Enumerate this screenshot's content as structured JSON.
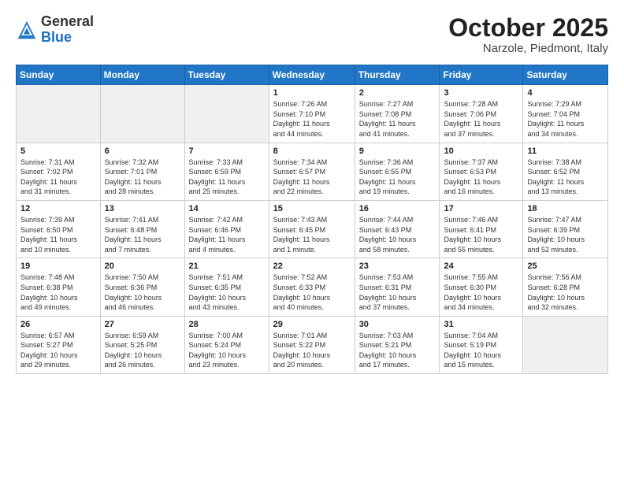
{
  "header": {
    "logo_general": "General",
    "logo_blue": "Blue",
    "month_title": "October 2025",
    "location": "Narzole, Piedmont, Italy"
  },
  "weekdays": [
    "Sunday",
    "Monday",
    "Tuesday",
    "Wednesday",
    "Thursday",
    "Friday",
    "Saturday"
  ],
  "weeks": [
    [
      {
        "day": "",
        "info": ""
      },
      {
        "day": "",
        "info": ""
      },
      {
        "day": "",
        "info": ""
      },
      {
        "day": "1",
        "info": "Sunrise: 7:26 AM\nSunset: 7:10 PM\nDaylight: 11 hours\nand 44 minutes."
      },
      {
        "day": "2",
        "info": "Sunrise: 7:27 AM\nSunset: 7:08 PM\nDaylight: 11 hours\nand 41 minutes."
      },
      {
        "day": "3",
        "info": "Sunrise: 7:28 AM\nSunset: 7:06 PM\nDaylight: 11 hours\nand 37 minutes."
      },
      {
        "day": "4",
        "info": "Sunrise: 7:29 AM\nSunset: 7:04 PM\nDaylight: 11 hours\nand 34 minutes."
      }
    ],
    [
      {
        "day": "5",
        "info": "Sunrise: 7:31 AM\nSunset: 7:02 PM\nDaylight: 11 hours\nand 31 minutes."
      },
      {
        "day": "6",
        "info": "Sunrise: 7:32 AM\nSunset: 7:01 PM\nDaylight: 11 hours\nand 28 minutes."
      },
      {
        "day": "7",
        "info": "Sunrise: 7:33 AM\nSunset: 6:59 PM\nDaylight: 11 hours\nand 25 minutes."
      },
      {
        "day": "8",
        "info": "Sunrise: 7:34 AM\nSunset: 6:57 PM\nDaylight: 11 hours\nand 22 minutes."
      },
      {
        "day": "9",
        "info": "Sunrise: 7:36 AM\nSunset: 6:55 PM\nDaylight: 11 hours\nand 19 minutes."
      },
      {
        "day": "10",
        "info": "Sunrise: 7:37 AM\nSunset: 6:53 PM\nDaylight: 11 hours\nand 16 minutes."
      },
      {
        "day": "11",
        "info": "Sunrise: 7:38 AM\nSunset: 6:52 PM\nDaylight: 11 hours\nand 13 minutes."
      }
    ],
    [
      {
        "day": "12",
        "info": "Sunrise: 7:39 AM\nSunset: 6:50 PM\nDaylight: 11 hours\nand 10 minutes."
      },
      {
        "day": "13",
        "info": "Sunrise: 7:41 AM\nSunset: 6:48 PM\nDaylight: 11 hours\nand 7 minutes."
      },
      {
        "day": "14",
        "info": "Sunrise: 7:42 AM\nSunset: 6:46 PM\nDaylight: 11 hours\nand 4 minutes."
      },
      {
        "day": "15",
        "info": "Sunrise: 7:43 AM\nSunset: 6:45 PM\nDaylight: 11 hours\nand 1 minute."
      },
      {
        "day": "16",
        "info": "Sunrise: 7:44 AM\nSunset: 6:43 PM\nDaylight: 10 hours\nand 58 minutes."
      },
      {
        "day": "17",
        "info": "Sunrise: 7:46 AM\nSunset: 6:41 PM\nDaylight: 10 hours\nand 55 minutes."
      },
      {
        "day": "18",
        "info": "Sunrise: 7:47 AM\nSunset: 6:39 PM\nDaylight: 10 hours\nand 52 minutes."
      }
    ],
    [
      {
        "day": "19",
        "info": "Sunrise: 7:48 AM\nSunset: 6:38 PM\nDaylight: 10 hours\nand 49 minutes."
      },
      {
        "day": "20",
        "info": "Sunrise: 7:50 AM\nSunset: 6:36 PM\nDaylight: 10 hours\nand 46 minutes."
      },
      {
        "day": "21",
        "info": "Sunrise: 7:51 AM\nSunset: 6:35 PM\nDaylight: 10 hours\nand 43 minutes."
      },
      {
        "day": "22",
        "info": "Sunrise: 7:52 AM\nSunset: 6:33 PM\nDaylight: 10 hours\nand 40 minutes."
      },
      {
        "day": "23",
        "info": "Sunrise: 7:53 AM\nSunset: 6:31 PM\nDaylight: 10 hours\nand 37 minutes."
      },
      {
        "day": "24",
        "info": "Sunrise: 7:55 AM\nSunset: 6:30 PM\nDaylight: 10 hours\nand 34 minutes."
      },
      {
        "day": "25",
        "info": "Sunrise: 7:56 AM\nSunset: 6:28 PM\nDaylight: 10 hours\nand 32 minutes."
      }
    ],
    [
      {
        "day": "26",
        "info": "Sunrise: 6:57 AM\nSunset: 5:27 PM\nDaylight: 10 hours\nand 29 minutes."
      },
      {
        "day": "27",
        "info": "Sunrise: 6:59 AM\nSunset: 5:25 PM\nDaylight: 10 hours\nand 26 minutes."
      },
      {
        "day": "28",
        "info": "Sunrise: 7:00 AM\nSunset: 5:24 PM\nDaylight: 10 hours\nand 23 minutes."
      },
      {
        "day": "29",
        "info": "Sunrise: 7:01 AM\nSunset: 5:22 PM\nDaylight: 10 hours\nand 20 minutes."
      },
      {
        "day": "30",
        "info": "Sunrise: 7:03 AM\nSunset: 5:21 PM\nDaylight: 10 hours\nand 17 minutes."
      },
      {
        "day": "31",
        "info": "Sunrise: 7:04 AM\nSunset: 5:19 PM\nDaylight: 10 hours\nand 15 minutes."
      },
      {
        "day": "",
        "info": ""
      }
    ]
  ]
}
